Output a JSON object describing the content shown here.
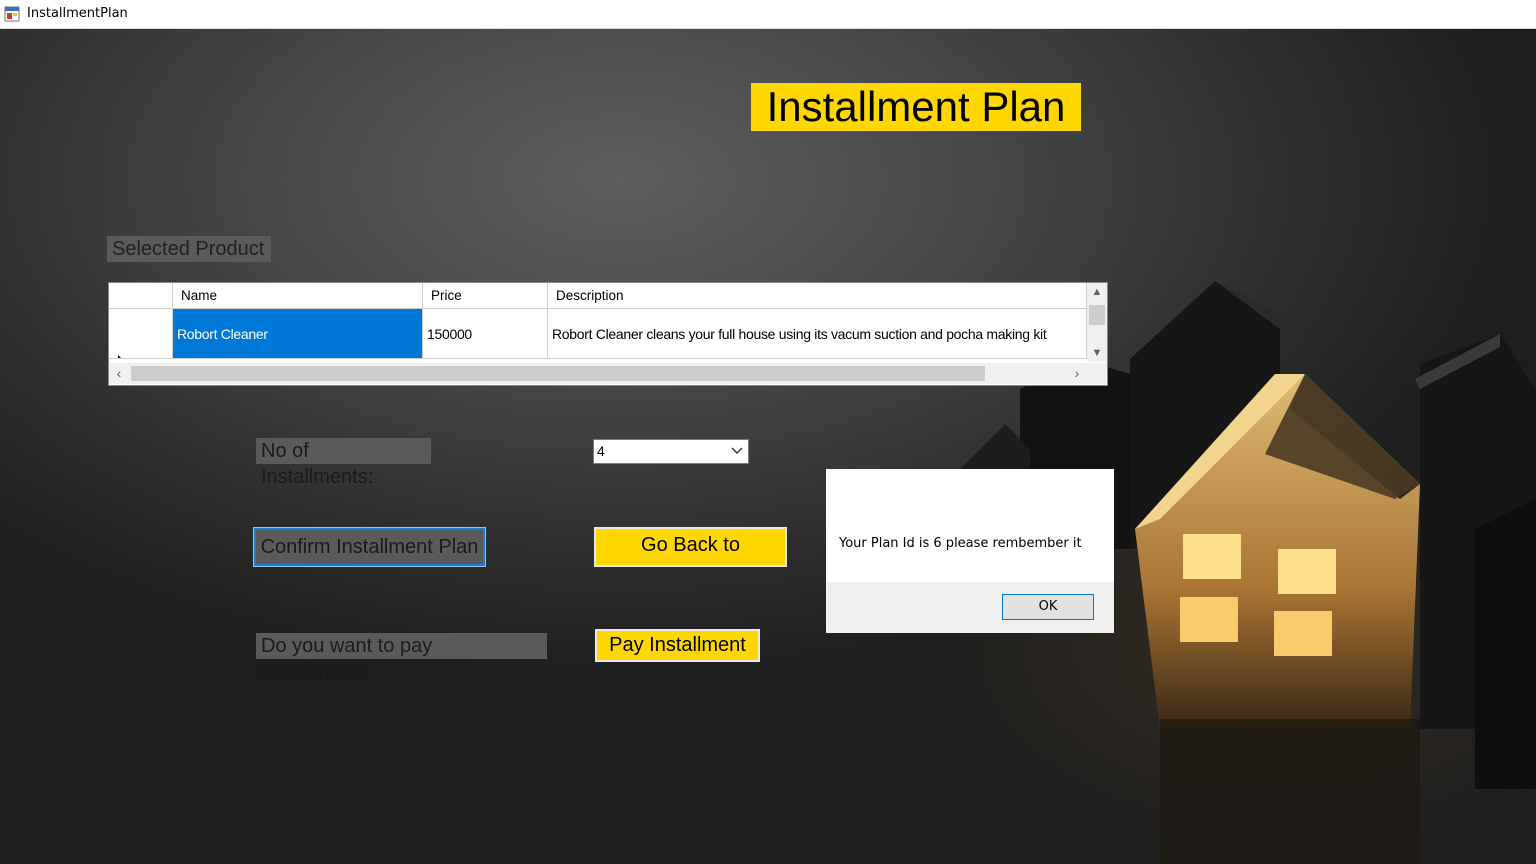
{
  "window": {
    "title": "InstallmentPlan"
  },
  "heading": "Installment Plan",
  "labels": {
    "selected_product": "Selected Product",
    "no_of_installments": "No of Installments:",
    "pay_question": "Do you want to pay installment?"
  },
  "grid": {
    "columns": [
      "Name",
      "Price",
      "Description"
    ],
    "rows": [
      {
        "name": "Robort  Cleaner",
        "price": "150000",
        "description": "Robort Cleaner cleans your full house using its vacum suction and pocha making kit"
      }
    ]
  },
  "installments": {
    "selected": "4"
  },
  "buttons": {
    "confirm": "Confirm Installment Plan",
    "go_back": "Go Back to",
    "pay": "Pay Installment"
  },
  "dialog": {
    "message": "Your Plan Id is 6 please rembember it",
    "ok": "OK"
  },
  "colors": {
    "accent_yellow": "#ffd700",
    "selection_blue": "#0078d7"
  }
}
